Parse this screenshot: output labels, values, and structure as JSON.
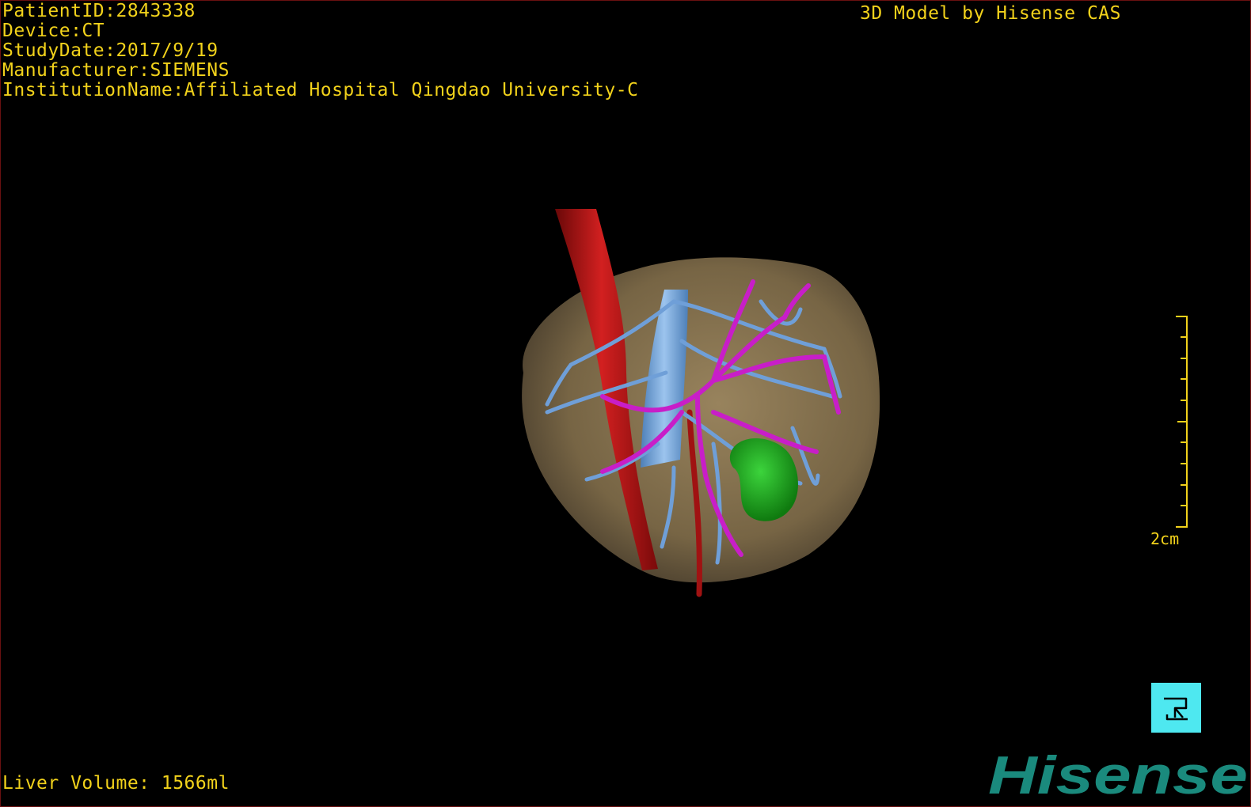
{
  "overlay": {
    "patient_id": "PatientID:2843338",
    "device": "Device:CT",
    "study_date": "StudyDate:2017/9/19",
    "manufacturer": "Manufacturer:SIEMENS",
    "institution": "InstitutionName:Affiliated Hospital Qingdao University-C",
    "watermark": "3D Model by Hisense CAS",
    "liver_volume": "Liver Volume: 1566ml",
    "scale_label": "2cm"
  },
  "brand": {
    "name": "Hisense",
    "color": "#1a8a7d"
  },
  "colors": {
    "background": "#000000",
    "overlay_text": "#f2d21b",
    "liver": "#8a7552",
    "artery": "#b81414",
    "portal_vein": "#6f9fd8",
    "hepatic_vein": "#c81ec8",
    "tumor": "#22b022",
    "orientation_widget": "#4ee8f0"
  },
  "icons": {
    "orientation": "orientation-cube-icon"
  }
}
